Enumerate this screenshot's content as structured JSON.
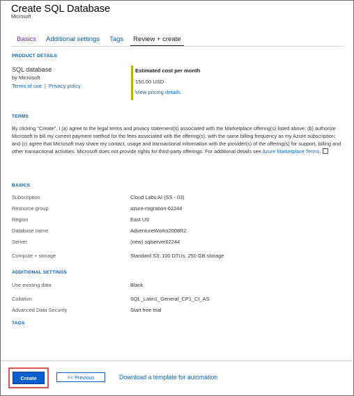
{
  "header": {
    "title": "Create SQL Database",
    "subtitle": "Microsoft"
  },
  "tabs": [
    {
      "label": "Basics"
    },
    {
      "label": "Additional settings"
    },
    {
      "label": "Tags"
    },
    {
      "label": "Review + create"
    }
  ],
  "product_details": {
    "heading": "PRODUCT DETAILS",
    "name": "SQL database",
    "by": "by Microsoft",
    "terms_link": "Terms of use",
    "separator": "|",
    "privacy_link": "Privacy policy",
    "cost_title": "Estimated cost per month",
    "cost_value": "150.00 USD",
    "pricing_link": "View pricing details"
  },
  "terms": {
    "heading": "TERMS",
    "text": "By clicking \"Create\", I (a) agree to the legal terms and privacy statement(s) associated with the Marketplace offering(s) listed above; (b) authorize Microsoft to bill my current payment method for the fees associated with the offering(s), with the same billing frequency as my Azure subscription; and (c) agree that Microsoft may share my contact, usage and transactional information with the provider(s) of the offering(s) for support, billing and other transactional activities. Microsoft does not provide rights for third-party offerings. For additional details see",
    "link": "Azure Marketplace Terms."
  },
  "basics": {
    "heading": "BASICS",
    "rows": [
      {
        "key": "Subscription",
        "value": "Cloud Labs AI (SS - 03)"
      },
      {
        "key": "Resource group",
        "value": "azure-migration-62244"
      },
      {
        "key": "Region",
        "value": "East US"
      },
      {
        "key": "Database name",
        "value": "AdventureWorks2008R2"
      },
      {
        "key": "Server",
        "value": "(new) sqlserver62244"
      },
      {
        "key": "Compute + storage",
        "value": "Standard S3: 100 DTUs, 250 GB storage"
      }
    ]
  },
  "additional": {
    "heading": "ADDITIONAL SETTINGS",
    "rows": [
      {
        "key": "Use existing data",
        "value": "Blank"
      },
      {
        "key": "Collation",
        "value": "SQL_Latin1_General_CP1_CI_AS"
      },
      {
        "key": "Advanced Data Security",
        "value": "Start free trial"
      }
    ]
  },
  "tags": {
    "heading": "TAGS"
  },
  "footer": {
    "create_label": "Create",
    "previous_label": "<< Previous",
    "download_label": "Download a template for automation"
  },
  "colors": {
    "accent": "#0a5fcf",
    "link": "#0a64c2",
    "highlight": "#d9534f",
    "cost_bar": "#b5b800"
  }
}
